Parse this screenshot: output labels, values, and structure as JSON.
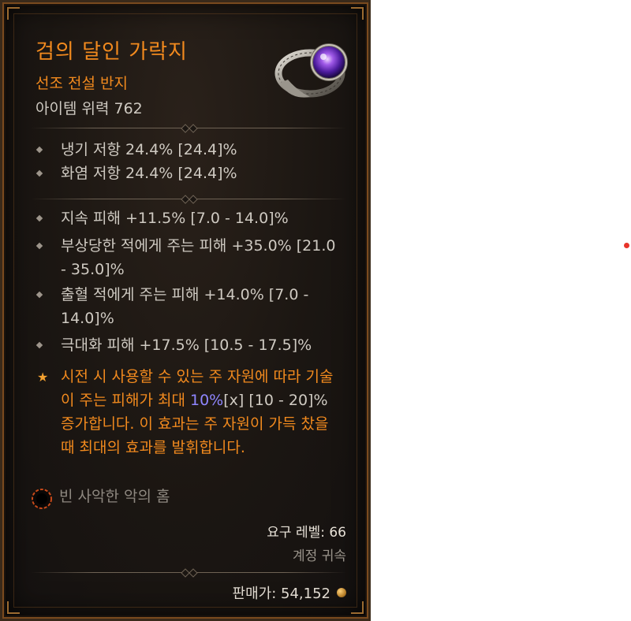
{
  "item": {
    "name": "검의 달인 가락지",
    "type": "선조 전설 반지",
    "power": "아이템 위력 762"
  },
  "implicits": [
    "냉기 저항 24.4% [24.4]%",
    "화염 저항 24.4% [24.4]%"
  ],
  "affixes": [
    "지속 피해 +11.5% [7.0 - 14.0]%",
    "부상당한 적에게 주는 피해 +35.0% [21.0 - 35.0]%",
    "출혈 적에게 주는 피해 +14.0% [7.0 - 14.0]%",
    "극대화 피해 +17.5% [10.5 - 17.5]%"
  ],
  "legendary": {
    "before": "시전 시 사용할 수 있는 주 자원에 따라 기술이 주는 피해가 최대 ",
    "value": "10%",
    "multiplier": "[x]",
    "range": "[10 - 20]%",
    "after": " 증가합니다. 이 효과는 주 자원이 가득 찼을 때 최대의 효과를 발휘합니다."
  },
  "socket": "빈 사악한 악의 홈",
  "requirement": "요구 레벨: 66",
  "binding": "계정 귀속",
  "sell_value": "판매가: 54,152",
  "colors": {
    "legendary_orange": "#f28a1e",
    "affix_text": "#cfcac2",
    "highlight": "#8f86ff"
  },
  "icons": {
    "item": "ring-icon",
    "socket": "malignant-socket-icon",
    "currency": "gold-coin-icon"
  }
}
